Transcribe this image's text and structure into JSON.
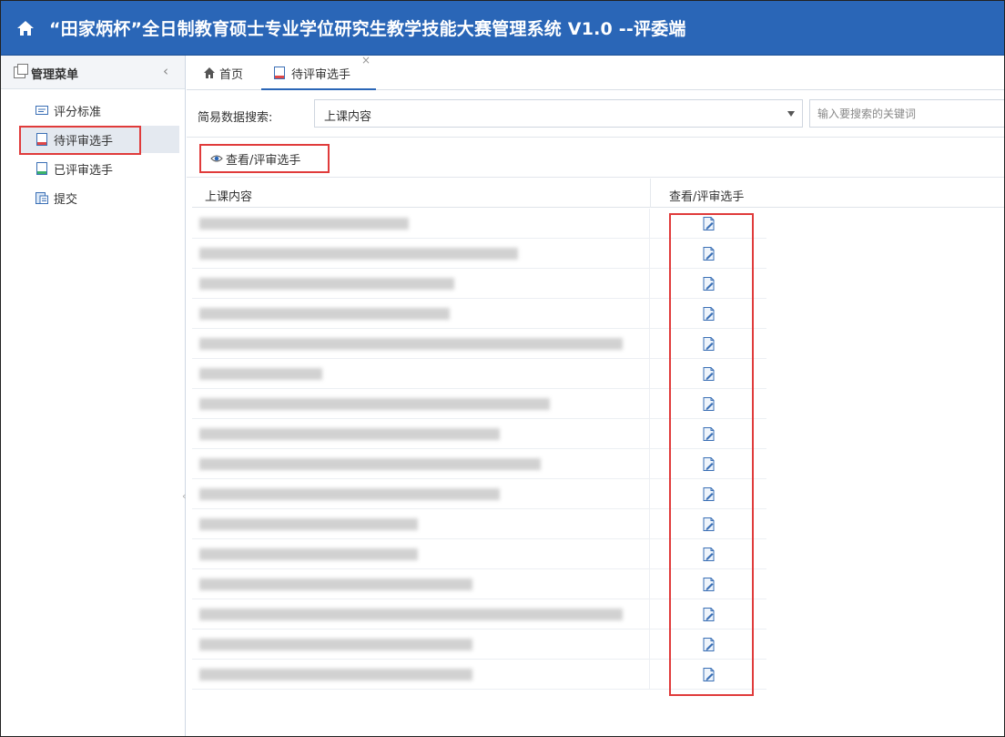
{
  "app": {
    "title": "“田家炳杯”全日制教育硕士专业学位研究生教学技能大赛管理系统 V1.0 --评委端"
  },
  "sidebar": {
    "header": "管理菜单",
    "collapse_glyph": "‹",
    "items": [
      {
        "label": "评分标准",
        "icon": "scoring-standard-icon"
      },
      {
        "label": "待评审选手",
        "icon": "pending-contestant-icon"
      },
      {
        "label": "已评审选手",
        "icon": "reviewed-contestant-icon"
      },
      {
        "label": "提交",
        "icon": "submit-icon"
      }
    ],
    "active_index": 1
  },
  "tabs": [
    {
      "label": "首页",
      "icon": "home-icon"
    },
    {
      "label": "待评审选手",
      "icon": "pending-contestant-icon",
      "close": "×"
    }
  ],
  "search": {
    "label": "简易数据搜索:",
    "field_value": "上课内容",
    "keyword_placeholder": "输入要搜索的关键词"
  },
  "toolbar": {
    "view_review_label": "查看/评审选手"
  },
  "table": {
    "columns": [
      "上课内容",
      "查看/评审选手"
    ],
    "row_count": 16,
    "row_action_icon": "edit-document-icon"
  },
  "colors": {
    "header_bg": "#2a66b7",
    "highlight": "#e03b3b"
  }
}
